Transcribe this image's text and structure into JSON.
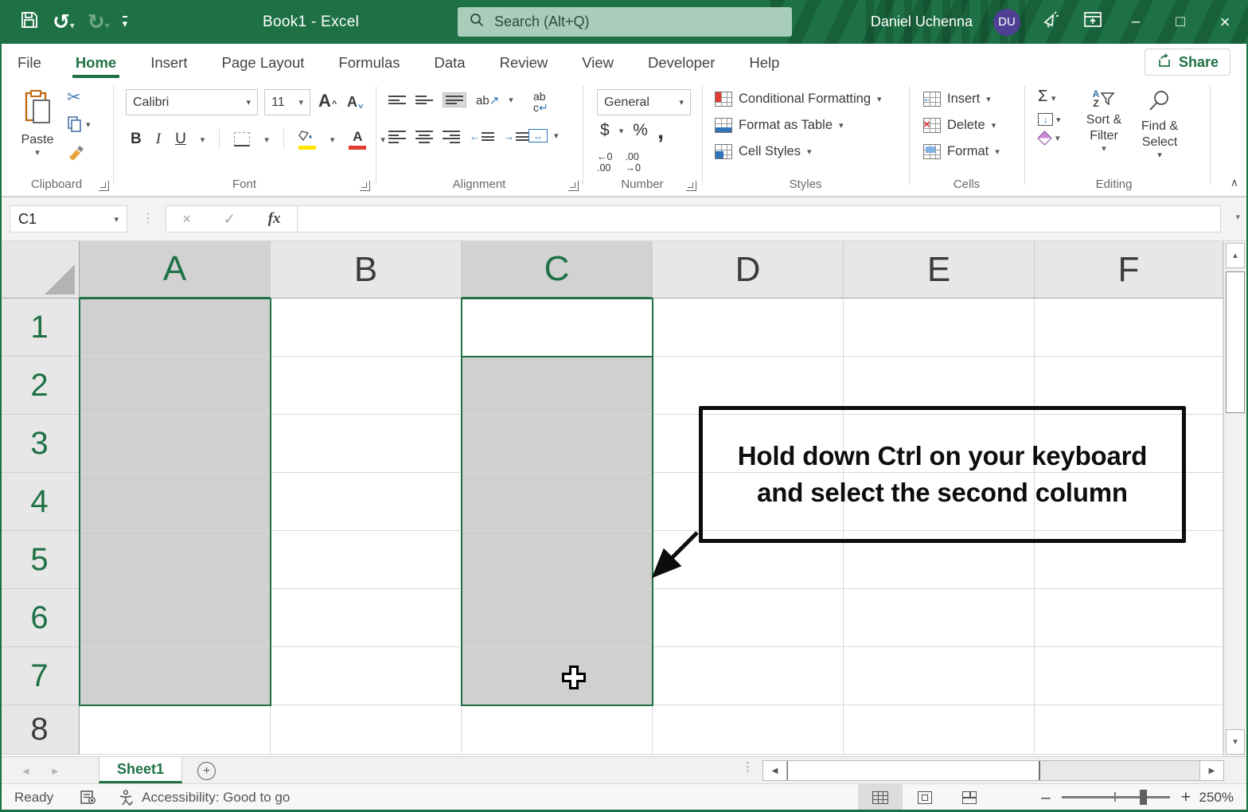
{
  "titlebar": {
    "title": "Book1 - Excel",
    "search_placeholder": "Search (Alt+Q)",
    "user_name": "Daniel Uchenna",
    "user_initials": "DU"
  },
  "menu": {
    "items": [
      "File",
      "Home",
      "Insert",
      "Page Layout",
      "Formulas",
      "Data",
      "Review",
      "View",
      "Developer",
      "Help"
    ],
    "active": "Home",
    "share_label": "Share"
  },
  "ribbon": {
    "clipboard": {
      "label": "Clipboard",
      "paste_label": "Paste"
    },
    "font": {
      "label": "Font",
      "font_name": "Calibri",
      "font_size": "11"
    },
    "alignment": {
      "label": "Alignment"
    },
    "number": {
      "label": "Number",
      "format": "General"
    },
    "styles": {
      "label": "Styles",
      "items": [
        "Conditional Formatting",
        "Format as Table",
        "Cell Styles"
      ]
    },
    "cells": {
      "label": "Cells",
      "items": [
        "Insert",
        "Delete",
        "Format"
      ]
    },
    "editing": {
      "label": "Editing",
      "sort_filter": "Sort & Filter",
      "find_select": "Find & Select"
    }
  },
  "formula_bar": {
    "name_box": "C1",
    "fx_label": "fx",
    "value": ""
  },
  "grid": {
    "columns": [
      "A",
      "B",
      "C",
      "D",
      "E",
      "F"
    ],
    "rows": [
      "1",
      "2",
      "3",
      "4",
      "5",
      "6",
      "7",
      "8"
    ],
    "selected_columns": [
      "A",
      "C"
    ],
    "selected_row_count": 7,
    "active_cell": "C1"
  },
  "callout": {
    "line1": "Hold down Ctrl on your keyboard",
    "line2": "and select the second column"
  },
  "sheet_tabs": {
    "active_tab": "Sheet1"
  },
  "status_bar": {
    "ready": "Ready",
    "accessibility": "Accessibility: Good to go",
    "zoom_level": "250%"
  },
  "icons": {
    "dropdown": "▾",
    "undo": "↺",
    "redo": "↻",
    "cut": "✂",
    "bold": "B",
    "italic": "I",
    "underline": "U",
    "letter_a": "A",
    "caret": "^",
    "orientation": "ab",
    "wrap_line1": "ab",
    "wrap_line2": "c",
    "return_arrow": "↵",
    "arrow_up_right": "↗",
    "merge_arrows": "↔",
    "autosum": "Σ",
    "dollar": "$",
    "percent": "%",
    "comma": ",",
    "increase_decimal": "←0\n.00",
    "decrease_decimal": ".00\n→0",
    "down_arrow": "↓",
    "sort_a": "A",
    "sort_z": "Z",
    "collapse_ribbon": "∧",
    "cancel": "×",
    "enter": "✓",
    "minimize": "–",
    "maximize": "□",
    "close": "×",
    "dots_vertical": "⋮",
    "dots_2": "⋮",
    "nav_left": "◄",
    "nav_right": "►",
    "new_sheet_plus": "+",
    "up_triangle": "▲",
    "down_triangle": "▼",
    "left_triangle": "◀",
    "right_triangle": "▶",
    "zoom_out": "–",
    "zoom_in": "+"
  },
  "colors": {
    "brand_green": "#1E7145",
    "selection_gray": "#D0D0D0",
    "avatar_purple": "#4F4093"
  }
}
